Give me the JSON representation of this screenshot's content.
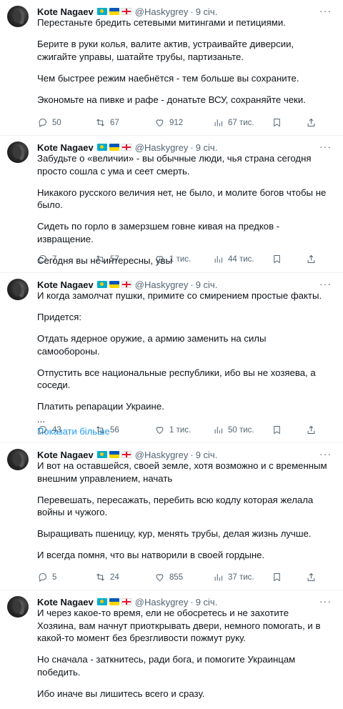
{
  "tweets": [
    {
      "name": "Kote Nagaev",
      "handle": "@Haskygrey",
      "time": "9 січ.",
      "paragraphs": [
        "Перестаньте бредить сетевыми митингами и петициями.",
        "Берите в руки колья, валите актив, устраивайте диверсии, сжигайте управы, шатайте трубы, партизаньте.",
        "Чем быстрее режим наебнётся - тем больше вы сохраните.",
        "Экономьте на пивке и рафе - донатьте ВСУ, сохраняйте чеки."
      ],
      "show_more": "",
      "replies": "50",
      "retweets": "67",
      "likes": "912",
      "views": "67 тис."
    },
    {
      "name": "Kote Nagaev",
      "handle": "@Haskygrey",
      "time": "9 січ.",
      "paragraphs": [
        "Забудьте о «величии» - вы обычные люди, чья страна сегодня просто сошла с ума и сеет смерть.",
        "Никакого русского величия нет, не было, и молите богов чтобы не было.",
        "Сидеть по горло в замерзшем говне кивая на предков - извращение.",
        "Сегодня вы не интересны, увы"
      ],
      "show_more": "",
      "replies": "7",
      "retweets": "57",
      "likes": "1 тис.",
      "views": "44 тис."
    },
    {
      "name": "Kote Nagaev",
      "handle": "@Haskygrey",
      "time": "9 січ.",
      "paragraphs": [
        "И когда замолчат пушки, примите со смирением простые факты.",
        "Придется:",
        "Отдать ядерное оружие, а армию заменить на силы самообороны.",
        "Отпустить все национальные республики, ибо вы не хозяева, а соседи.",
        "Платить репарации Украине.\n..."
      ],
      "show_more": "Показати більше",
      "replies": "43",
      "retweets": "56",
      "likes": "1 тис.",
      "views": "50 тис."
    },
    {
      "name": "Kote Nagaev",
      "handle": "@Haskygrey",
      "time": "9 січ.",
      "paragraphs": [
        "И вот на оставшейся, своей земле, хотя возможно и с временным внешним управлением, начать",
        "Перевешать, пересажать, перебить всю кодлу которая желала войны и чужого.",
        "Выращивать пшеницу, кур, менять трубы, делая жизнь лучше.",
        "И всегда помня, что вы натворили в своей гордыне."
      ],
      "show_more": "",
      "replies": "5",
      "retweets": "24",
      "likes": "855",
      "views": "37 тис."
    },
    {
      "name": "Kote Nagaev",
      "handle": "@Haskygrey",
      "time": "9 січ.",
      "paragraphs": [
        "И через какое-то время, ели не обосретесь и не захотите Хозяина, вам начнут приоткрывать двери, немного помогать, и в какой-то момент без брезгливости пожмут руку.",
        "Но сначала - заткнитесь, ради бога, и помогите Украинцам победить.",
        "Ибо иначе вы лишитесь всего и сразу."
      ],
      "show_more": "",
      "replies": "",
      "retweets": "",
      "likes": "",
      "views": ""
    }
  ]
}
